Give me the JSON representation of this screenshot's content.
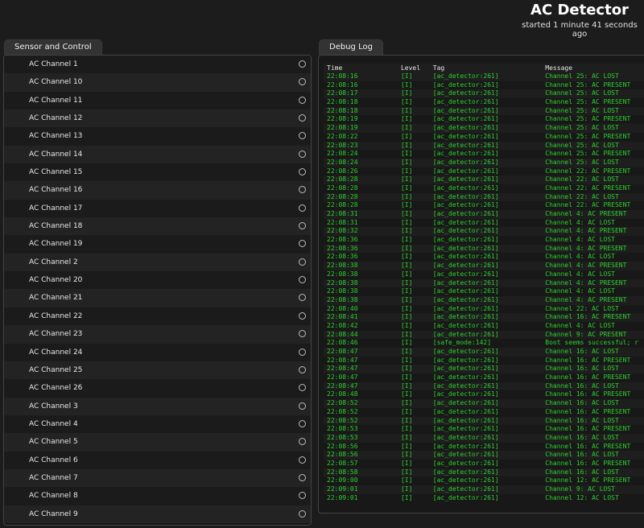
{
  "header": {
    "title": "AC Detector",
    "subtitle": "started 1 minute 41 seconds ago"
  },
  "tabs": {
    "sensor": "Sensor and Control",
    "debug": "Debug Log"
  },
  "channels": [
    "AC Channel 1",
    "AC Channel 10",
    "AC Channel 11",
    "AC Channel 12",
    "AC Channel 13",
    "AC Channel 14",
    "AC Channel 15",
    "AC Channel 16",
    "AC Channel 17",
    "AC Channel 18",
    "AC Channel 19",
    "AC Channel 2",
    "AC Channel 20",
    "AC Channel 21",
    "AC Channel 22",
    "AC Channel 23",
    "AC Channel 24",
    "AC Channel 25",
    "AC Channel 26",
    "AC Channel 3",
    "AC Channel 4",
    "AC Channel 5",
    "AC Channel 6",
    "AC Channel 7",
    "AC Channel 8",
    "AC Channel 9"
  ],
  "log": {
    "columns": [
      "Time",
      "Level",
      "Tag",
      "Message"
    ],
    "rows": [
      [
        "22:08:16",
        "[I]",
        "[ac_detector:261]",
        "Channel 25: AC LOST"
      ],
      [
        "22:08:16",
        "[I]",
        "[ac_detector:261]",
        "Channel 25: AC PRESENT"
      ],
      [
        "22:08:17",
        "[I]",
        "[ac_detector:261]",
        "Channel 25: AC LOST"
      ],
      [
        "22:08:18",
        "[I]",
        "[ac_detector:261]",
        "Channel 25: AC PRESENT"
      ],
      [
        "22:08:18",
        "[I]",
        "[ac_detector:261]",
        "Channel 25: AC LOST"
      ],
      [
        "22:08:19",
        "[I]",
        "[ac_detector:261]",
        "Channel 25: AC PRESENT"
      ],
      [
        "22:08:19",
        "[I]",
        "[ac_detector:261]",
        "Channel 25: AC LOST"
      ],
      [
        "22:08:22",
        "[I]",
        "[ac_detector:261]",
        "Channel 25: AC PRESENT"
      ],
      [
        "22:08:23",
        "[I]",
        "[ac_detector:261]",
        "Channel 25: AC LOST"
      ],
      [
        "22:08:24",
        "[I]",
        "[ac_detector:261]",
        "Channel 25: AC PRESENT"
      ],
      [
        "22:08:24",
        "[I]",
        "[ac_detector:261]",
        "Channel 25: AC LOST"
      ],
      [
        "22:08:26",
        "[I]",
        "[ac_detector:261]",
        "Channel 22: AC PRESENT"
      ],
      [
        "22:08:28",
        "[I]",
        "[ac_detector:261]",
        "Channel 22: AC LOST"
      ],
      [
        "22:08:28",
        "[I]",
        "[ac_detector:261]",
        "Channel 22: AC PRESENT"
      ],
      [
        "22:08:28",
        "[I]",
        "[ac_detector:261]",
        "Channel 22: AC LOST"
      ],
      [
        "22:08:28",
        "[I]",
        "[ac_detector:261]",
        "Channel 22: AC PRESENT"
      ],
      [
        "22:08:31",
        "[I]",
        "[ac_detector:261]",
        "Channel 4: AC PRESENT"
      ],
      [
        "22:08:31",
        "[I]",
        "[ac_detector:261]",
        "Channel 4: AC LOST"
      ],
      [
        "22:08:32",
        "[I]",
        "[ac_detector:261]",
        "Channel 4: AC PRESENT"
      ],
      [
        "22:08:36",
        "[I]",
        "[ac_detector:261]",
        "Channel 4: AC LOST"
      ],
      [
        "22:08:36",
        "[I]",
        "[ac_detector:261]",
        "Channel 4: AC PRESENT"
      ],
      [
        "22:08:36",
        "[I]",
        "[ac_detector:261]",
        "Channel 4: AC LOST"
      ],
      [
        "22:08:38",
        "[I]",
        "[ac_detector:261]",
        "Channel 4: AC PRESENT"
      ],
      [
        "22:08:38",
        "[I]",
        "[ac_detector:261]",
        "Channel 4: AC LOST"
      ],
      [
        "22:08:38",
        "[I]",
        "[ac_detector:261]",
        "Channel 4: AC PRESENT"
      ],
      [
        "22:08:38",
        "[I]",
        "[ac_detector:261]",
        "Channel 4: AC LOST"
      ],
      [
        "22:08:38",
        "[I]",
        "[ac_detector:261]",
        "Channel 4: AC PRESENT"
      ],
      [
        "22:08:40",
        "[I]",
        "[ac_detector:261]",
        "Channel 22: AC LOST"
      ],
      [
        "22:08:41",
        "[I]",
        "[ac_detector:261]",
        "Channel 16: AC PRESENT"
      ],
      [
        "22:08:42",
        "[I]",
        "[ac_detector:261]",
        "Channel 4: AC LOST"
      ],
      [
        "22:08:44",
        "[I]",
        "[ac_detector:261]",
        "Channel 9: AC PRESENT"
      ],
      [
        "22:08:46",
        "[I]",
        "[safe_mode:142]",
        "Boot seems successful; r"
      ],
      [
        "22:08:47",
        "[I]",
        "[ac_detector:261]",
        "Channel 16: AC LOST"
      ],
      [
        "22:08:47",
        "[I]",
        "[ac_detector:261]",
        "Channel 16: AC PRESENT"
      ],
      [
        "22:08:47",
        "[I]",
        "[ac_detector:261]",
        "Channel 16: AC LOST"
      ],
      [
        "22:08:47",
        "[I]",
        "[ac_detector:261]",
        "Channel 16: AC PRESENT"
      ],
      [
        "22:08:47",
        "[I]",
        "[ac_detector:261]",
        "Channel 16: AC LOST"
      ],
      [
        "22:08:48",
        "[I]",
        "[ac_detector:261]",
        "Channel 16: AC PRESENT"
      ],
      [
        "22:08:52",
        "[I]",
        "[ac_detector:261]",
        "Channel 16: AC LOST"
      ],
      [
        "22:08:52",
        "[I]",
        "[ac_detector:261]",
        "Channel 16: AC PRESENT"
      ],
      [
        "22:08:52",
        "[I]",
        "[ac_detector:261]",
        "Channel 16: AC LOST"
      ],
      [
        "22:08:53",
        "[I]",
        "[ac_detector:261]",
        "Channel 16: AC PRESENT"
      ],
      [
        "22:08:53",
        "[I]",
        "[ac_detector:261]",
        "Channel 16: AC LOST"
      ],
      [
        "22:08:56",
        "[I]",
        "[ac_detector:261]",
        "Channel 16: AC PRESENT"
      ],
      [
        "22:08:56",
        "[I]",
        "[ac_detector:261]",
        "Channel 16: AC LOST"
      ],
      [
        "22:08:57",
        "[I]",
        "[ac_detector:261]",
        "Channel 16: AC PRESENT"
      ],
      [
        "22:08:58",
        "[I]",
        "[ac_detector:261]",
        "Channel 16: AC LOST"
      ],
      [
        "22:09:00",
        "[I]",
        "[ac_detector:261]",
        "Channel 12: AC PRESENT"
      ],
      [
        "22:09:01",
        "[I]",
        "[ac_detector:261]",
        "Channel 9: AC LOST"
      ],
      [
        "22:09:01",
        "[I]",
        "[ac_detector:261]",
        "Channel 12: AC LOST"
      ]
    ]
  },
  "colors": {
    "log_text": "#2ed12e",
    "background": "#1c1c1c"
  },
  "icons": {
    "channel_status": "radio-circle-icon"
  }
}
